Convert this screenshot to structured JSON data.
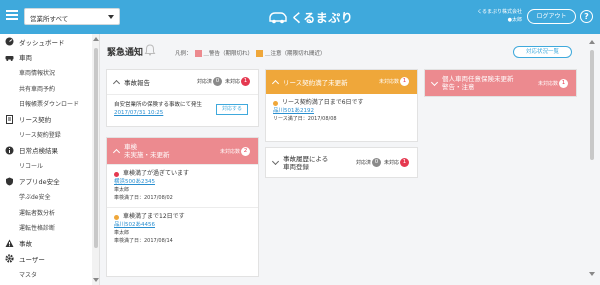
{
  "header": {
    "office_select": "営業所すべて",
    "logo_text": "くるまぷり",
    "company_line1": "くるまぷり株式会社",
    "company_line2": "●太郎",
    "logout_label": "ログアウト",
    "help_label": "?"
  },
  "sidebar": {
    "items": [
      {
        "label": "ダッシュボード",
        "icon": "dashboard-icon",
        "sub": false
      },
      {
        "label": "車両",
        "icon": "car-icon",
        "sub": false
      },
      {
        "label": "車両情報状況",
        "sub": true
      },
      {
        "label": "共有車両予約",
        "sub": true
      },
      {
        "label": "日報帳票ダウンロード",
        "sub": true
      },
      {
        "label": "リース契約",
        "icon": "document-icon",
        "sub": false
      },
      {
        "label": "リース契約登録",
        "sub": true
      },
      {
        "label": "日常点検結果",
        "icon": "info-icon",
        "sub": false
      },
      {
        "label": "リコール",
        "sub": true
      },
      {
        "label": "アプリde安全",
        "icon": "shield-icon",
        "sub": false
      },
      {
        "label": "学ぶde安全",
        "sub": true
      },
      {
        "label": "運転者数分析",
        "sub": true
      },
      {
        "label": "運転性格診断",
        "sub": true
      },
      {
        "label": "事故",
        "icon": "warning-icon",
        "sub": false
      },
      {
        "label": "ユーザー",
        "icon": "gear-icon",
        "sub": false
      },
      {
        "label": "マスタ",
        "sub": true
      }
    ]
  },
  "main": {
    "heading": "緊急通知",
    "legend_label": "凡例：",
    "legend_red": "＿警告（期限切れ）",
    "legend_orange": "＿注意（期限切れ間近）",
    "status_button": "対応状況一覧",
    "colors": {
      "accent": "#3fa9dc",
      "red": "#e53950",
      "orange": "#efa73a",
      "pink": "#ec8a8f"
    },
    "accident_card": {
      "title": "事故報告",
      "handled_label": "対応済",
      "handled_count": "0",
      "unhandled_label": "未対応",
      "unhandled_count": "1",
      "message": "自安営業所の保険する事故にて発生",
      "date": "2017/07/31 10:25",
      "action": "対応する"
    },
    "inspection_card": {
      "title_line1": "車検",
      "title_line2": "未実施・未更新",
      "count_label": "未対応数",
      "count": "2",
      "items": [
        {
          "title": "車検満了が過ぎています",
          "plate": "横浜500あ2345",
          "driver": "車太郎",
          "expiry": "車検満了日：2017/08/02"
        },
        {
          "title": "車検満了まで12日です",
          "plate": "品川502あ4456",
          "driver": "車太郎",
          "expiry": "車検満了日：2017/08/14"
        }
      ]
    },
    "lease_card": {
      "title": "リース契約満了未更新",
      "count_label": "未対応数",
      "count": "1",
      "item_title": "リース契約満了日まで6日です",
      "plate": "品川501あ2192",
      "expiry": "リース満了日：2017/08/08"
    },
    "damage_card": {
      "title_line1": "事故履歴による",
      "title_line2": "車両登録",
      "handled_label": "対応済",
      "handled_count": "0",
      "unhandled_label": "未対応",
      "unhandled_count": "1"
    },
    "insurance_card": {
      "title_line1": "個人車両任意保険未更新",
      "title_line2": "警告・注意",
      "count_label": "未対応数",
      "count": "1"
    }
  }
}
